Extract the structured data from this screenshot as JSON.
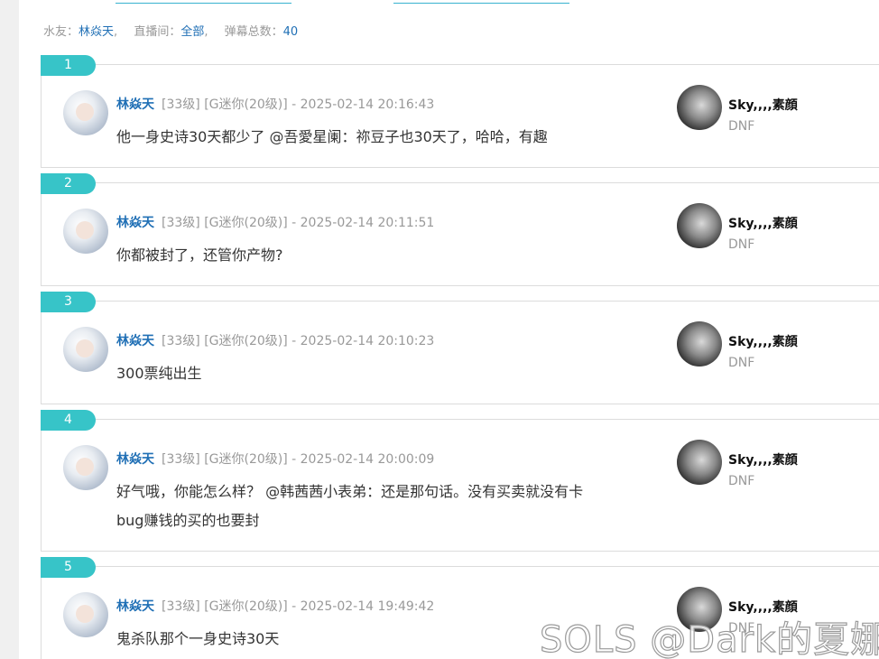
{
  "filter": {
    "user_label": "水友：",
    "user_value": "林焱天",
    "room_label": "直播间：",
    "room_value": "全部",
    "count_label": "弹幕总数：",
    "count_value": "40"
  },
  "comments": [
    {
      "index": "1",
      "user": "林焱天",
      "meta": "[33级] [G迷你(20级)] - 2025-02-14 20:16:43",
      "text": "他一身史诗30天都少了 @吾愛星阑：祢豆子也30天了，哈哈，有趣",
      "anchor_name": "Sky,,,,素顔",
      "anchor_tag": "DNF"
    },
    {
      "index": "2",
      "user": "林焱天",
      "meta": "[33级] [G迷你(20级)] - 2025-02-14 20:11:51",
      "text": "你都被封了，还管你产物?",
      "anchor_name": "Sky,,,,素顔",
      "anchor_tag": "DNF"
    },
    {
      "index": "3",
      "user": "林焱天",
      "meta": "[33级] [G迷你(20级)] - 2025-02-14 20:10:23",
      "text": "300票纯出生",
      "anchor_name": "Sky,,,,素顔",
      "anchor_tag": "DNF"
    },
    {
      "index": "4",
      "user": "林焱天",
      "meta": "[33级] [G迷你(20级)] - 2025-02-14 20:00:09",
      "text": "好气哦，你能怎么样？ @韩茜茜小表弟：还是那句话。没有买卖就没有卡bug赚钱的买的也要封",
      "anchor_name": "Sky,,,,素顔",
      "anchor_tag": "DNF"
    },
    {
      "index": "5",
      "user": "林焱天",
      "meta": "[33级] [G迷你(20级)] - 2025-02-14 19:49:42",
      "text": "鬼杀队那个一身史诗30天",
      "anchor_name": "Sky,,,,素顔",
      "anchor_tag": "DNF"
    }
  ],
  "watermark": "SOLS @Dark的夏娜"
}
